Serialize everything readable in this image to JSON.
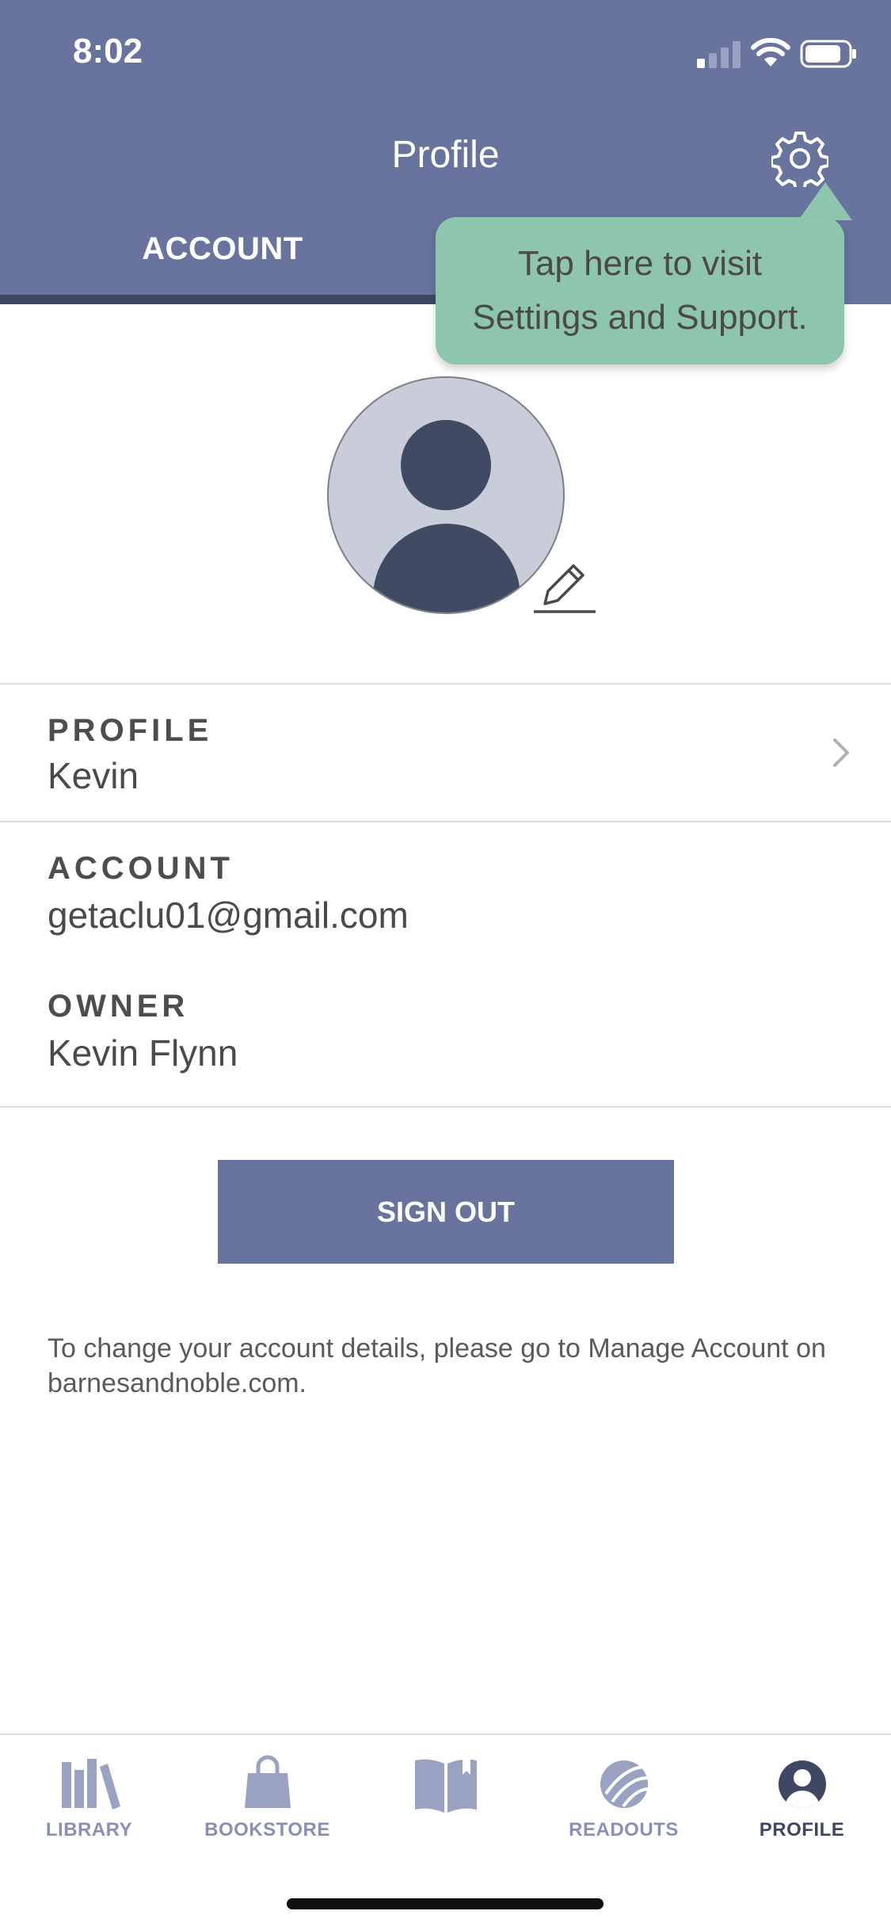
{
  "status_bar": {
    "time": "8:02"
  },
  "header": {
    "title": "Profile",
    "tab_account": "ACCOUNT"
  },
  "tooltip": {
    "text": "Tap here to visit Settings and Support."
  },
  "profile": {
    "label": "PROFILE",
    "value": "Kevin"
  },
  "account": {
    "label": "ACCOUNT",
    "value": "getaclu01@gmail.com"
  },
  "owner": {
    "label": "OWNER",
    "value": "Kevin Flynn"
  },
  "signout": {
    "label": "SIGN OUT"
  },
  "info_text": "To change your account details, please go to Manage Account on barnesandnoble.com.",
  "nav": {
    "library": "LIBRARY",
    "bookstore": "BOOKSTORE",
    "readouts": "READOUTS",
    "profile": "PROFILE"
  },
  "colors": {
    "header": "#68739e",
    "tooltip": "#8ec5ad",
    "nav_inactive": "#8891b3",
    "nav_active": "#3f4863"
  }
}
